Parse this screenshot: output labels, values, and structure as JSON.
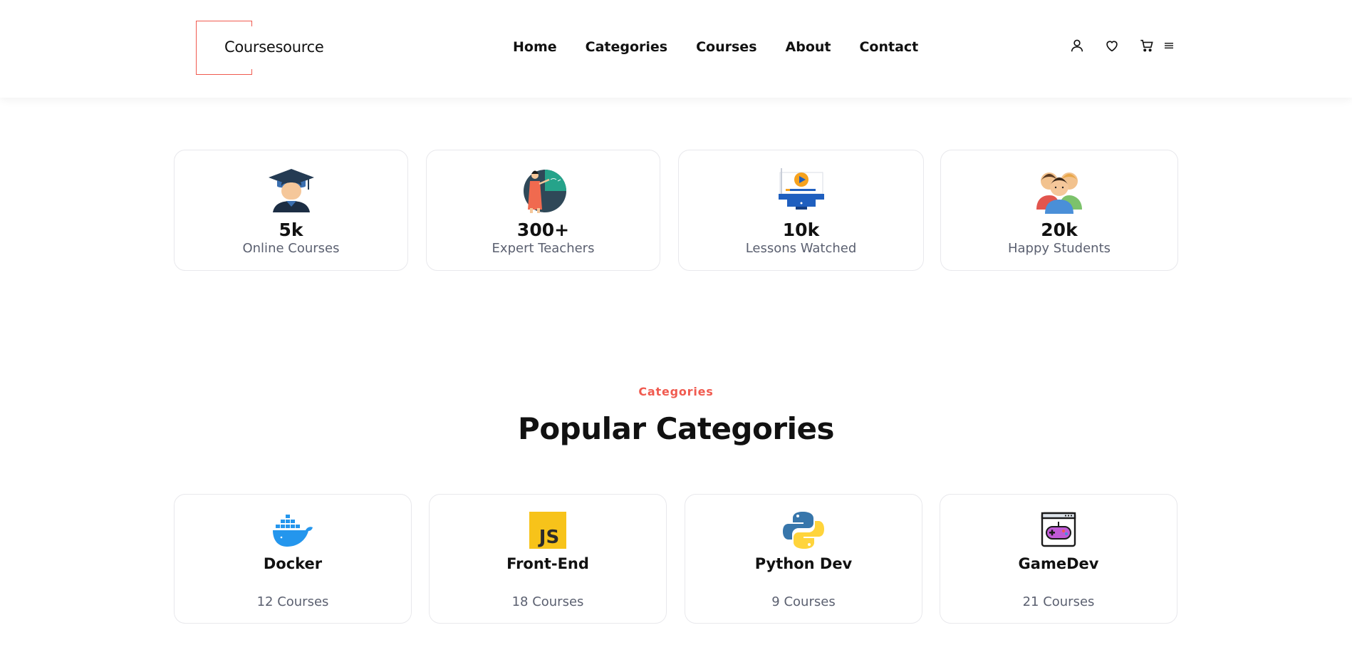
{
  "brand": {
    "name": "Coursesource",
    "accent_color": "#f05a4f"
  },
  "nav": {
    "items": [
      {
        "label": "Home"
      },
      {
        "label": "Categories"
      },
      {
        "label": "Courses"
      },
      {
        "label": "About"
      },
      {
        "label": "Contact"
      }
    ]
  },
  "header_icons": [
    "user-icon",
    "heart-icon",
    "cart-icon",
    "menu-icon"
  ],
  "stats": [
    {
      "value": "5k",
      "label": "Online Courses",
      "icon": "graduate-icon"
    },
    {
      "value": "300+",
      "label": "Expert Teachers",
      "icon": "teacher-icon"
    },
    {
      "value": "10k",
      "label": "Lessons Watched",
      "icon": "video-lesson-icon"
    },
    {
      "value": "20k",
      "label": "Happy Students",
      "icon": "students-icon"
    }
  ],
  "section": {
    "kicker": "Categories",
    "title": "Popular Categories"
  },
  "categories": [
    {
      "name": "Docker",
      "count": "12 Courses",
      "icon": "docker-icon",
      "color": "#2496ed"
    },
    {
      "name": "Front-End",
      "count": "18 Courses",
      "icon": "javascript-icon",
      "color": "#f7c31a"
    },
    {
      "name": "Python Dev",
      "count": "9 Courses",
      "icon": "python-icon",
      "color": "#3776ab"
    },
    {
      "name": "GameDev",
      "count": "21 Courses",
      "icon": "gamepad-icon",
      "color": "#c05ad6"
    }
  ]
}
